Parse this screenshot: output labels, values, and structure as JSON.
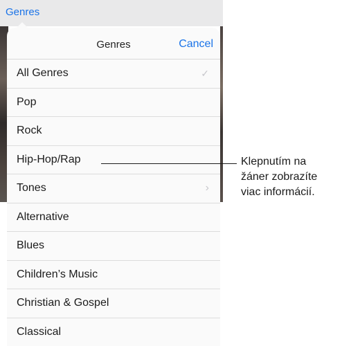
{
  "nav": {
    "genres_label": "Genres"
  },
  "sheet": {
    "title": "Genres",
    "cancel_label": "Cancel",
    "items": [
      {
        "label": "All Genres",
        "icon": "checkmark-icon"
      },
      {
        "label": "Pop"
      },
      {
        "label": "Rock"
      },
      {
        "label": "Hip-Hop/Rap"
      },
      {
        "label": "Tones",
        "icon": "chevron-right-icon"
      },
      {
        "label": "Alternative"
      },
      {
        "label": "Blues"
      },
      {
        "label": "Children’s Music"
      },
      {
        "label": "Christian & Gospel"
      },
      {
        "label": "Classical"
      }
    ]
  },
  "callout": {
    "lines": [
      "Klepnutím na",
      "žáner zobrazíte",
      "viac informácií."
    ]
  },
  "colors": {
    "accent": "#1a73e8",
    "separator": "#dcdcdc",
    "sheet": "#fafafa"
  }
}
